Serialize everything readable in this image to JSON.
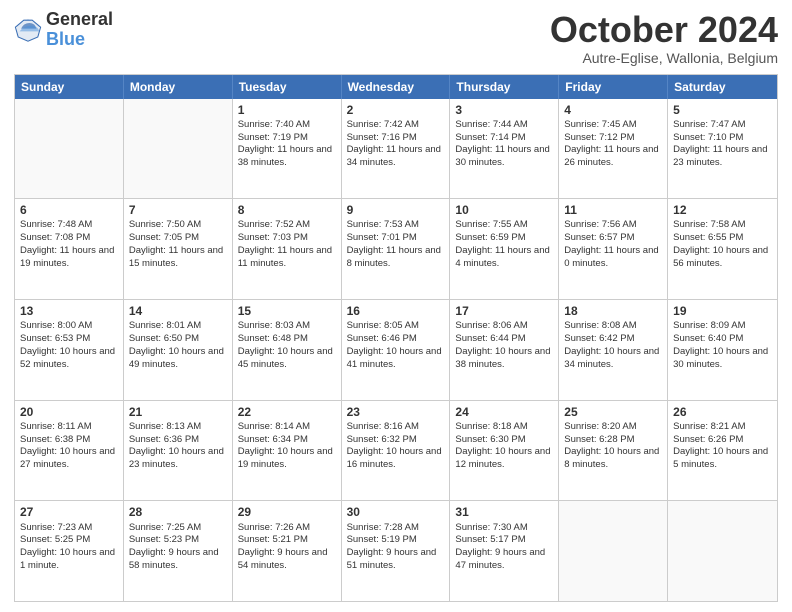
{
  "logo": {
    "line1": "General",
    "line2": "Blue"
  },
  "title": "October 2024",
  "subtitle": "Autre-Eglise, Wallonia, Belgium",
  "days": [
    "Sunday",
    "Monday",
    "Tuesday",
    "Wednesday",
    "Thursday",
    "Friday",
    "Saturday"
  ],
  "weeks": [
    [
      {
        "day": "",
        "sunrise": "",
        "sunset": "",
        "daylight": ""
      },
      {
        "day": "",
        "sunrise": "",
        "sunset": "",
        "daylight": ""
      },
      {
        "day": "1",
        "sunrise": "Sunrise: 7:40 AM",
        "sunset": "Sunset: 7:19 PM",
        "daylight": "Daylight: 11 hours and 38 minutes."
      },
      {
        "day": "2",
        "sunrise": "Sunrise: 7:42 AM",
        "sunset": "Sunset: 7:16 PM",
        "daylight": "Daylight: 11 hours and 34 minutes."
      },
      {
        "day": "3",
        "sunrise": "Sunrise: 7:44 AM",
        "sunset": "Sunset: 7:14 PM",
        "daylight": "Daylight: 11 hours and 30 minutes."
      },
      {
        "day": "4",
        "sunrise": "Sunrise: 7:45 AM",
        "sunset": "Sunset: 7:12 PM",
        "daylight": "Daylight: 11 hours and 26 minutes."
      },
      {
        "day": "5",
        "sunrise": "Sunrise: 7:47 AM",
        "sunset": "Sunset: 7:10 PM",
        "daylight": "Daylight: 11 hours and 23 minutes."
      }
    ],
    [
      {
        "day": "6",
        "sunrise": "Sunrise: 7:48 AM",
        "sunset": "Sunset: 7:08 PM",
        "daylight": "Daylight: 11 hours and 19 minutes."
      },
      {
        "day": "7",
        "sunrise": "Sunrise: 7:50 AM",
        "sunset": "Sunset: 7:05 PM",
        "daylight": "Daylight: 11 hours and 15 minutes."
      },
      {
        "day": "8",
        "sunrise": "Sunrise: 7:52 AM",
        "sunset": "Sunset: 7:03 PM",
        "daylight": "Daylight: 11 hours and 11 minutes."
      },
      {
        "day": "9",
        "sunrise": "Sunrise: 7:53 AM",
        "sunset": "Sunset: 7:01 PM",
        "daylight": "Daylight: 11 hours and 8 minutes."
      },
      {
        "day": "10",
        "sunrise": "Sunrise: 7:55 AM",
        "sunset": "Sunset: 6:59 PM",
        "daylight": "Daylight: 11 hours and 4 minutes."
      },
      {
        "day": "11",
        "sunrise": "Sunrise: 7:56 AM",
        "sunset": "Sunset: 6:57 PM",
        "daylight": "Daylight: 11 hours and 0 minutes."
      },
      {
        "day": "12",
        "sunrise": "Sunrise: 7:58 AM",
        "sunset": "Sunset: 6:55 PM",
        "daylight": "Daylight: 10 hours and 56 minutes."
      }
    ],
    [
      {
        "day": "13",
        "sunrise": "Sunrise: 8:00 AM",
        "sunset": "Sunset: 6:53 PM",
        "daylight": "Daylight: 10 hours and 52 minutes."
      },
      {
        "day": "14",
        "sunrise": "Sunrise: 8:01 AM",
        "sunset": "Sunset: 6:50 PM",
        "daylight": "Daylight: 10 hours and 49 minutes."
      },
      {
        "day": "15",
        "sunrise": "Sunrise: 8:03 AM",
        "sunset": "Sunset: 6:48 PM",
        "daylight": "Daylight: 10 hours and 45 minutes."
      },
      {
        "day": "16",
        "sunrise": "Sunrise: 8:05 AM",
        "sunset": "Sunset: 6:46 PM",
        "daylight": "Daylight: 10 hours and 41 minutes."
      },
      {
        "day": "17",
        "sunrise": "Sunrise: 8:06 AM",
        "sunset": "Sunset: 6:44 PM",
        "daylight": "Daylight: 10 hours and 38 minutes."
      },
      {
        "day": "18",
        "sunrise": "Sunrise: 8:08 AM",
        "sunset": "Sunset: 6:42 PM",
        "daylight": "Daylight: 10 hours and 34 minutes."
      },
      {
        "day": "19",
        "sunrise": "Sunrise: 8:09 AM",
        "sunset": "Sunset: 6:40 PM",
        "daylight": "Daylight: 10 hours and 30 minutes."
      }
    ],
    [
      {
        "day": "20",
        "sunrise": "Sunrise: 8:11 AM",
        "sunset": "Sunset: 6:38 PM",
        "daylight": "Daylight: 10 hours and 27 minutes."
      },
      {
        "day": "21",
        "sunrise": "Sunrise: 8:13 AM",
        "sunset": "Sunset: 6:36 PM",
        "daylight": "Daylight: 10 hours and 23 minutes."
      },
      {
        "day": "22",
        "sunrise": "Sunrise: 8:14 AM",
        "sunset": "Sunset: 6:34 PM",
        "daylight": "Daylight: 10 hours and 19 minutes."
      },
      {
        "day": "23",
        "sunrise": "Sunrise: 8:16 AM",
        "sunset": "Sunset: 6:32 PM",
        "daylight": "Daylight: 10 hours and 16 minutes."
      },
      {
        "day": "24",
        "sunrise": "Sunrise: 8:18 AM",
        "sunset": "Sunset: 6:30 PM",
        "daylight": "Daylight: 10 hours and 12 minutes."
      },
      {
        "day": "25",
        "sunrise": "Sunrise: 8:20 AM",
        "sunset": "Sunset: 6:28 PM",
        "daylight": "Daylight: 10 hours and 8 minutes."
      },
      {
        "day": "26",
        "sunrise": "Sunrise: 8:21 AM",
        "sunset": "Sunset: 6:26 PM",
        "daylight": "Daylight: 10 hours and 5 minutes."
      }
    ],
    [
      {
        "day": "27",
        "sunrise": "Sunrise: 7:23 AM",
        "sunset": "Sunset: 5:25 PM",
        "daylight": "Daylight: 10 hours and 1 minute."
      },
      {
        "day": "28",
        "sunrise": "Sunrise: 7:25 AM",
        "sunset": "Sunset: 5:23 PM",
        "daylight": "Daylight: 9 hours and 58 minutes."
      },
      {
        "day": "29",
        "sunrise": "Sunrise: 7:26 AM",
        "sunset": "Sunset: 5:21 PM",
        "daylight": "Daylight: 9 hours and 54 minutes."
      },
      {
        "day": "30",
        "sunrise": "Sunrise: 7:28 AM",
        "sunset": "Sunset: 5:19 PM",
        "daylight": "Daylight: 9 hours and 51 minutes."
      },
      {
        "day": "31",
        "sunrise": "Sunrise: 7:30 AM",
        "sunset": "Sunset: 5:17 PM",
        "daylight": "Daylight: 9 hours and 47 minutes."
      },
      {
        "day": "",
        "sunrise": "",
        "sunset": "",
        "daylight": ""
      },
      {
        "day": "",
        "sunrise": "",
        "sunset": "",
        "daylight": ""
      }
    ]
  ]
}
